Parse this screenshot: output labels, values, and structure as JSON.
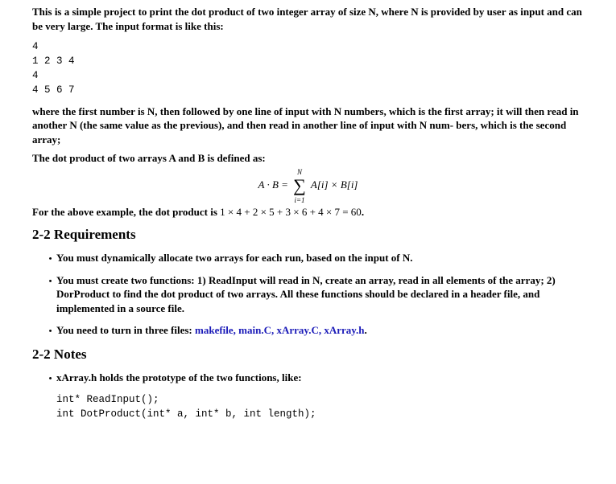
{
  "intro": "This is a simple project to print the dot product of two integer array of size N, where N is provided by user as input and can be very large. The input format is like this:",
  "sample_input": "4\n1 2 3 4\n4\n4 5 6 7",
  "explain1": "where the first number is N, then followed by one line of input with N numbers, which is the first array; it will then read in another N (the same value as the previous), and then read in another line of input with N num- bers, which is the second array;",
  "explain2": "The dot product of two arrays A and B is defined as:",
  "formula": {
    "lhs": "A · B = ",
    "sup": "N",
    "sub": "i=1",
    "rhs": " A[i] × B[i]"
  },
  "example_prefix": "For the above example, the dot product is ",
  "example_math": "1 × 4 + 2 × 5 + 3 × 6 + 4 × 7 = 60",
  "example_suffix": ".",
  "requirements_heading": "2-2  Requirements",
  "reqs": {
    "r1": "You must dynamically allocate two arrays for each run, based on the input of N.",
    "r2": "You must create two functions: 1) ReadInput will read in N, create an array, read in all elements of the array; 2) DorProduct to find the dot product of two arrays. All these functions should be declared in a header file, and implemented in a source file.",
    "r3_prefix": "You need to turn in three files: ",
    "r3_files": "makefile,  main.C,  xArray.C,  xArray.h",
    "r3_suffix": "."
  },
  "notes_heading": "2-2  Notes",
  "note1": "xArray.h holds the prototype of the two functions, like:",
  "note_code": "int* ReadInput();\nint DotProduct(int* a, int* b, int length);",
  "chart_data": {
    "type": "table",
    "title": "Sample input and expected dot product",
    "input_N": 4,
    "array_A": [
      1,
      2,
      3,
      4
    ],
    "array_B": [
      4,
      5,
      6,
      7
    ],
    "dot_product": 60,
    "expression": "1×4 + 2×5 + 3×6 + 4×7 = 60"
  }
}
